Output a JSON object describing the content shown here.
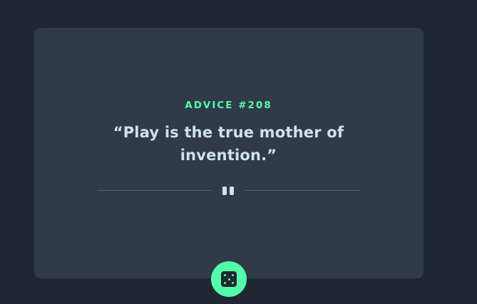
{
  "advice": {
    "label": "ADVICE #208",
    "quote": "“Play is the true mother of invention.”"
  },
  "divider": {
    "icon": "pause-icon"
  },
  "actions": {
    "dice_icon": "dice-icon"
  },
  "colors": {
    "background": "#202632",
    "card": "#313a48",
    "accent": "#52ffa8",
    "text": "#cee3e9",
    "divider": "#4f5d74"
  }
}
